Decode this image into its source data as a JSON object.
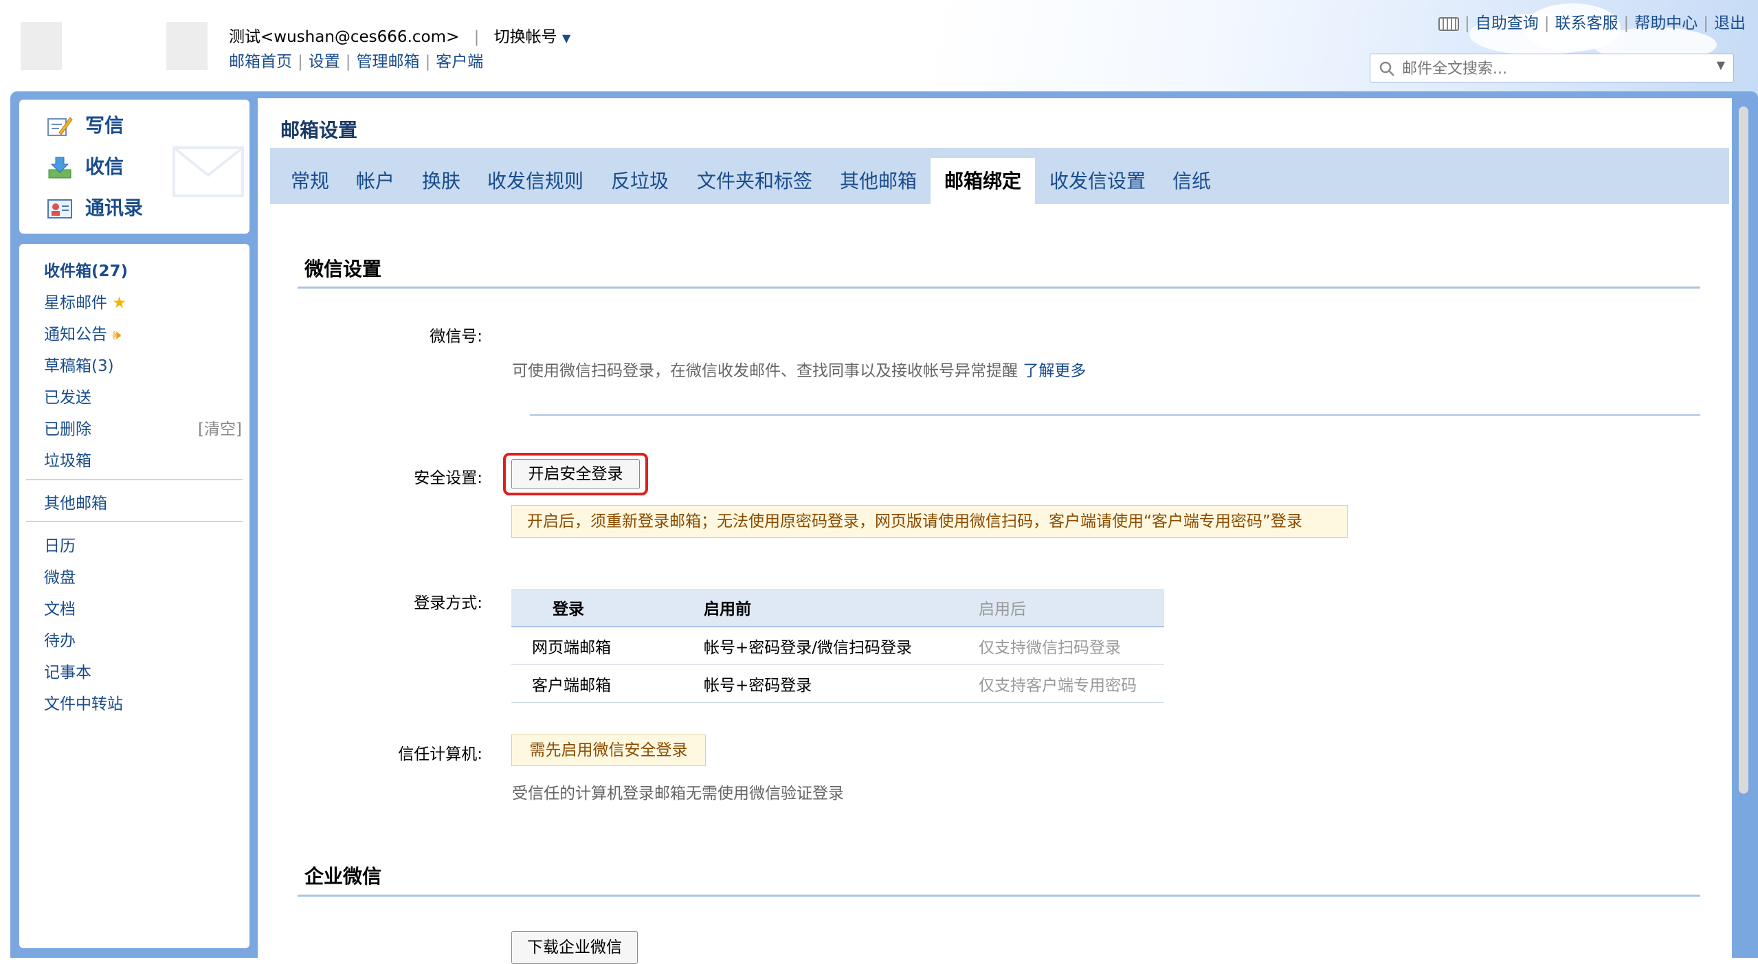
{
  "header": {
    "account": "测试<wushan@ces666.com>",
    "switch_account": "切换帐号",
    "nav_links": [
      "邮箱首页",
      "设置",
      "管理邮箱",
      "客户端"
    ],
    "top_links": [
      "自助查询",
      "联系客服",
      "帮助中心",
      "退出"
    ],
    "search_placeholder": "邮件全文搜索..."
  },
  "sidebar": {
    "actions": [
      "写信",
      "收信",
      "通讯录"
    ],
    "folders": [
      {
        "label": "收件箱(27)"
      },
      {
        "label": "星标邮件"
      },
      {
        "label": "通知公告"
      },
      {
        "label": "草稿箱(3)"
      },
      {
        "label": "已发送"
      },
      {
        "label": "已删除",
        "extra": "[清空]"
      },
      {
        "label": "垃圾箱"
      }
    ],
    "other_mailbox": "其他邮箱",
    "apps": [
      "日历",
      "微盘",
      "文档",
      "待办",
      "记事本",
      "文件中转站"
    ]
  },
  "page_title": "邮箱设置",
  "tabs": [
    "常规",
    "帐户",
    "换肤",
    "收发信规则",
    "反垃圾",
    "文件夹和标签",
    "其他邮箱",
    "邮箱绑定",
    "收发信设置",
    "信纸"
  ],
  "active_tab": "邮箱绑定",
  "wechat": {
    "section_title": "微信设置",
    "wechat_id_label": "微信号:",
    "wechat_desc": "可使用微信扫码登录，在微信收发邮件、查找同事以及接收帐号异常提醒",
    "learn_more": "了解更多",
    "security_label": "安全设置:",
    "security_button": "开启安全登录",
    "security_warning": "开启后，须重新登录邮箱；无法使用原密码登录，网页版请使用微信扫码，客户端请使用“客户端专用密码”登录",
    "login_method_label": "登录方式:",
    "login_table": {
      "headers": [
        "登录",
        "启用前",
        "启用后"
      ],
      "rows": [
        [
          "网页端邮箱",
          "帐号+密码登录/微信扫码登录",
          "仅支持微信扫码登录"
        ],
        [
          "客户端邮箱",
          "帐号+密码登录",
          "仅支持客户端专用密码"
        ]
      ]
    },
    "trusted_label": "信任计算机:",
    "trusted_notice": "需先启用微信安全登录",
    "trusted_desc": "受信任的计算机登录邮箱无需使用微信验证登录"
  },
  "enterprise": {
    "section_title": "企业微信",
    "download_button": "下载企业微信"
  },
  "colors": {
    "link": "#1a4c8c",
    "frame": "#7aa7e0",
    "tabs_bg": "#c8dbf1",
    "highlight": "#e02020"
  }
}
